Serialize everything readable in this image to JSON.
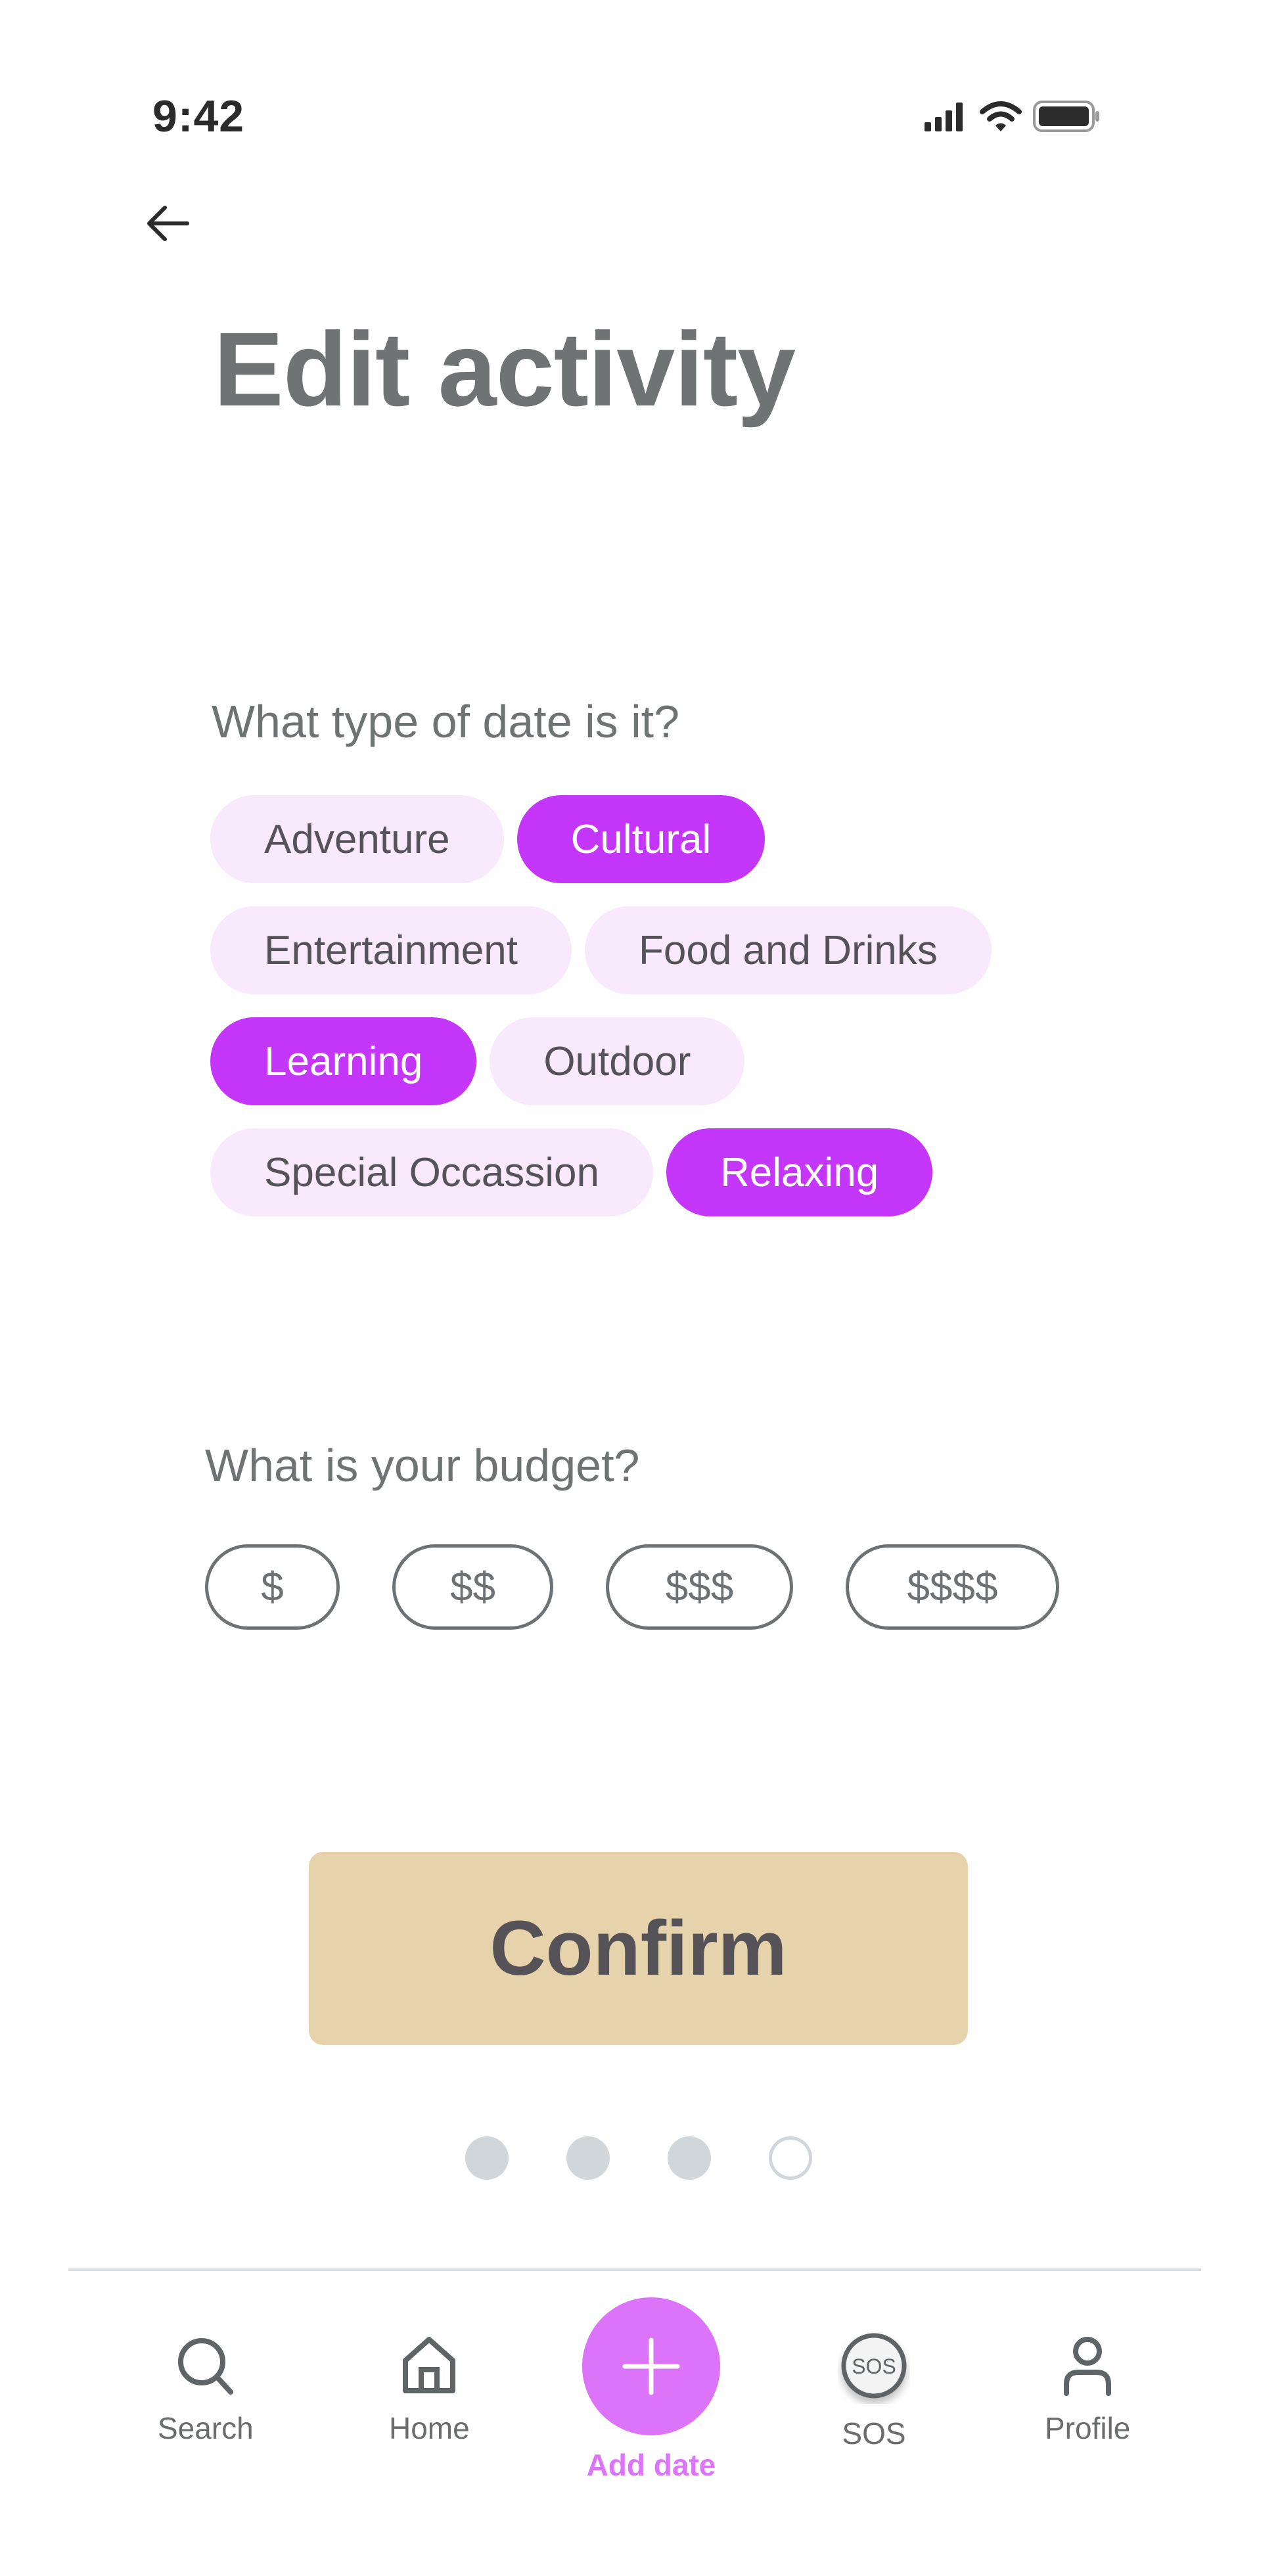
{
  "status_bar": {
    "time": "9:42",
    "icons": [
      "signal-icon",
      "wifi-icon",
      "battery-icon"
    ]
  },
  "header": {
    "back_icon": "arrow-left-icon",
    "title": "Edit activity"
  },
  "date_type": {
    "question": "What type of date is it?",
    "options": [
      {
        "label": "Adventure",
        "selected": false
      },
      {
        "label": "Cultural",
        "selected": true
      },
      {
        "label": "Entertainment",
        "selected": false
      },
      {
        "label": "Food and Drinks",
        "selected": false
      },
      {
        "label": "Learning",
        "selected": true
      },
      {
        "label": "Outdoor",
        "selected": false
      },
      {
        "label": "Special Occassion",
        "selected": false
      },
      {
        "label": "Relaxing",
        "selected": true
      }
    ]
  },
  "budget": {
    "question": "What is your budget?",
    "options": [
      {
        "label": "$"
      },
      {
        "label": "$$"
      },
      {
        "label": "$$$"
      },
      {
        "label": "$$$$"
      }
    ]
  },
  "confirm_label": "Confirm",
  "pagination": {
    "total": 4,
    "current": 4,
    "filled": [
      true,
      true,
      true,
      false
    ]
  },
  "colors": {
    "selected_chip": "#c536fb",
    "unselected_chip": "#f8eafc",
    "confirm_bg": "#e6d2ab",
    "accent": "#dc74fa"
  },
  "nav": [
    {
      "label": "Search",
      "icon": "search-icon",
      "active": false
    },
    {
      "label": "Home",
      "icon": "home-icon",
      "active": false
    },
    {
      "label": "Add date",
      "icon": "plus-icon",
      "active": true
    },
    {
      "label": "SOS",
      "icon": "sos-icon",
      "active": false
    },
    {
      "label": "Profile",
      "icon": "profile-icon",
      "active": false
    }
  ]
}
